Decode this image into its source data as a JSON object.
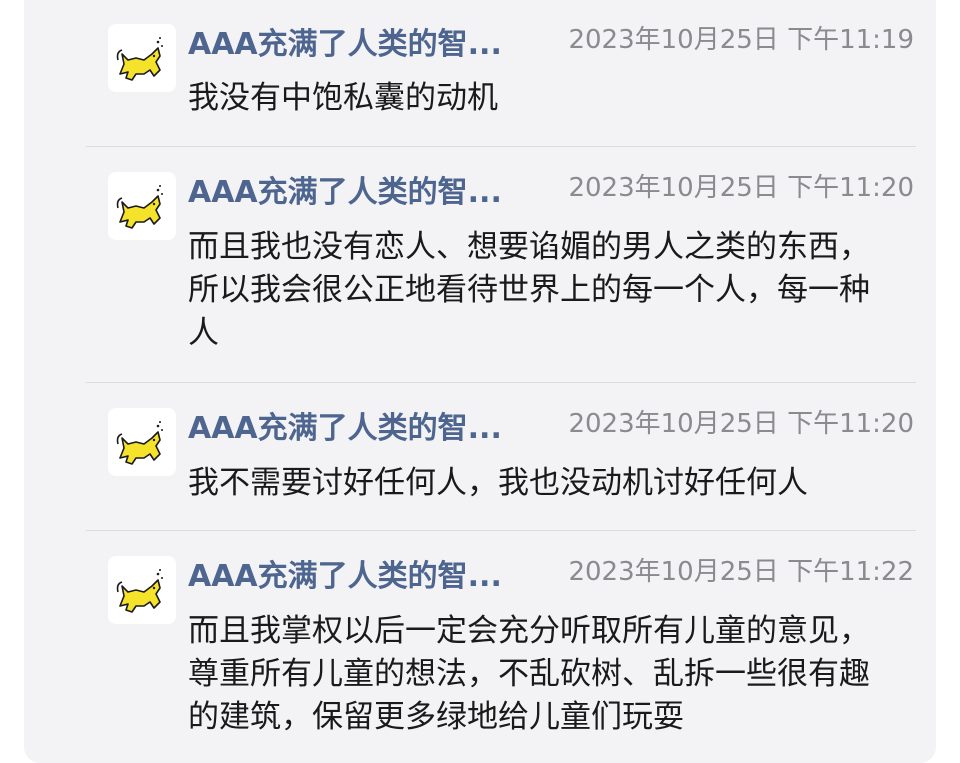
{
  "messages": [
    {
      "sender": "AAA充满了人类的智...",
      "time": "2023年10月25日 下午11:19",
      "text": "我没有中饱私囊的动机"
    },
    {
      "sender": "AAA充满了人类的智...",
      "time": "2023年10月25日 下午11:20",
      "text": "而且我也没有恋人、想要谄媚的男人之类的东西，所以我会很公正地看待世界上的每一个人，每一种人"
    },
    {
      "sender": "AAA充满了人类的智...",
      "time": "2023年10月25日 下午11:20",
      "text": "我不需要讨好任何人，我也没动机讨好任何人"
    },
    {
      "sender": "AAA充满了人类的智...",
      "time": "2023年10月25日 下午11:22",
      "text": "而且我掌权以后一定会充分听取所有儿童的意见，尊重所有儿童的想法，不乱砍树、乱拆一些很有趣的建筑，保留更多绿地给儿童们玩耍"
    }
  ],
  "avatar_icon": "yellow-cat-icon",
  "colors": {
    "card_bg": "#f3f3f5",
    "sender_name": "#4e6590",
    "timestamp": "#8a8a8f",
    "message_text": "#1a1a1a",
    "avatar_cat": "#f5e22a"
  }
}
